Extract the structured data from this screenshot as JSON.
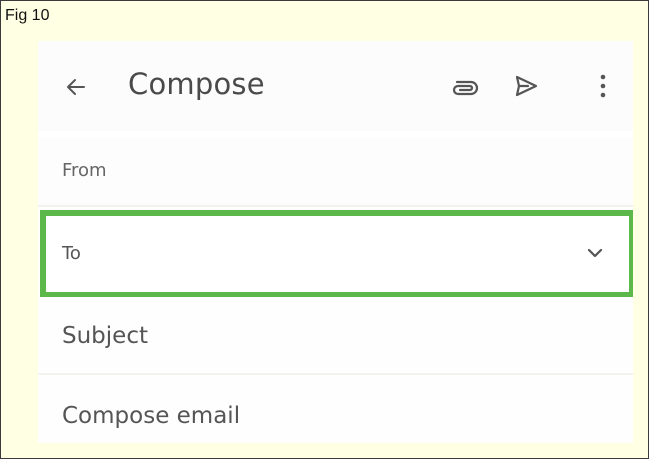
{
  "figure": {
    "label": "Fig 10"
  },
  "header": {
    "back_icon": "arrow-left-icon",
    "title": "Compose",
    "attach_icon": "paperclip-icon",
    "send_icon": "send-icon",
    "more_icon": "more-vert-icon"
  },
  "fields": {
    "from_label": "From",
    "to_label": "To",
    "to_dropdown_icon": "chevron-down-icon",
    "subject_placeholder": "Subject",
    "body_placeholder": "Compose email"
  },
  "colors": {
    "figure_background": "#ffffe3",
    "highlight": "#5cb84a",
    "icon": "#555555",
    "text": "#555555"
  }
}
